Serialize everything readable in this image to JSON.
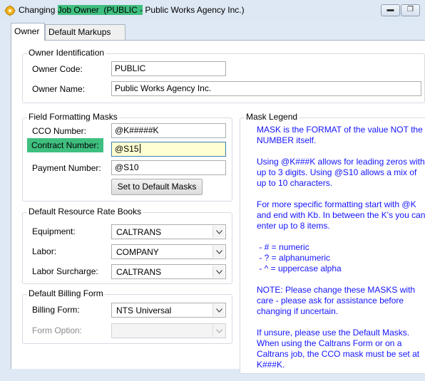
{
  "window": {
    "title_prefix": "Changing ",
    "title_highlight": "Job Owner  (PUBLIC -",
    "title_suffix": " Public Works Agency Inc.)",
    "minimize_glyph": "▬",
    "maximize_glyph": "❐"
  },
  "tabs": [
    {
      "label": "Owner",
      "active": true
    },
    {
      "label": "Default Markups",
      "active": false
    }
  ],
  "owner_identification": {
    "title": "Owner Identification",
    "code_label": "Owner Code:",
    "code_value": "PUBLIC",
    "name_label": "Owner Name:",
    "name_value": "Public Works Agency Inc."
  },
  "masks": {
    "title": "Field Formatting Masks",
    "cco_label": "CCO Number:",
    "cco_value": "@K#####K",
    "contract_label": "Contract Number:",
    "contract_value": "@S15",
    "payment_label": "Payment Number:",
    "payment_value": "@S10",
    "default_button": "Set to Default Masks"
  },
  "rate_books": {
    "title": "Default Resource Rate Books",
    "equipment_label": "Equipment:",
    "equipment_value": "CALTRANS",
    "labor_label": "Labor:",
    "labor_value": "COMPANY",
    "surcharge_label": "Labor Surcharge:",
    "surcharge_value": "CALTRANS"
  },
  "billing": {
    "title": "Default Billing Form",
    "form_label": "Billing Form:",
    "form_value": "NTS Universal",
    "option_label": "Form Option:",
    "option_value": ""
  },
  "mask_legend": {
    "title": "Mask Legend",
    "p1": "MASK is the FORMAT of the value NOT the NUMBER itself.",
    "p2": "Using @K###K allows for leading zeros with up to 3 digits. Using @S10 allows a mix of up to 10 characters.",
    "p3": "For more specific formatting start with @K and end with Kb. In between the K's you can enter up to 8 items.",
    "item1": " - # = numeric",
    "item2": " - ? = alphanumeric",
    "item3": " - ^ = uppercase alpha",
    "p4": "NOTE: Please change these MASKS with care - please ask for assistance before changing if uncertain.",
    "p5": "If unsure, please use the Default Masks. When using the Caltrans Form or on a Caltrans job, the CCO mask must be set at K###K."
  },
  "colors": {
    "highlight": "#3fbf7f",
    "legend_text": "#1414ff",
    "focused_field": "#ffffd1"
  }
}
